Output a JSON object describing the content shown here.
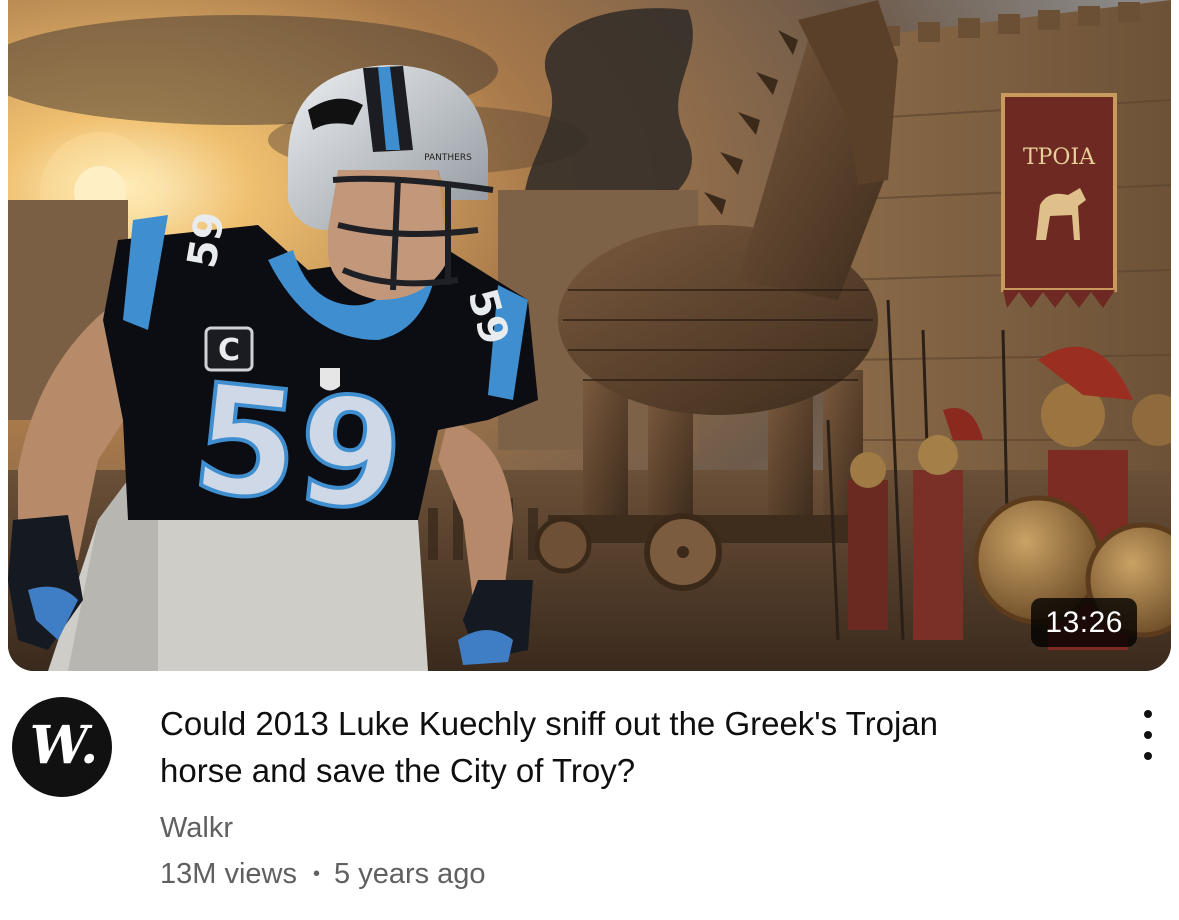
{
  "video": {
    "title": "Could 2013 Luke Kuechly sniff out the Greek's Trojan horse and save the City of Troy?",
    "duration": "13:26",
    "channel": "Walkr",
    "views": "13M views",
    "separator": "•",
    "age": "5 years ago",
    "avatar_letter": "W.",
    "menu_icon": "more-vert-icon"
  },
  "thumbnail": {
    "banner_text": "ΤΡΟΙΑ",
    "jersey_number": "59",
    "captain_patch": "C",
    "helmet_text": "PANTHERS",
    "jersey_color": "#0c0d12",
    "accent_color": "#3f8fd0",
    "sky_color": "#c99a5a"
  }
}
